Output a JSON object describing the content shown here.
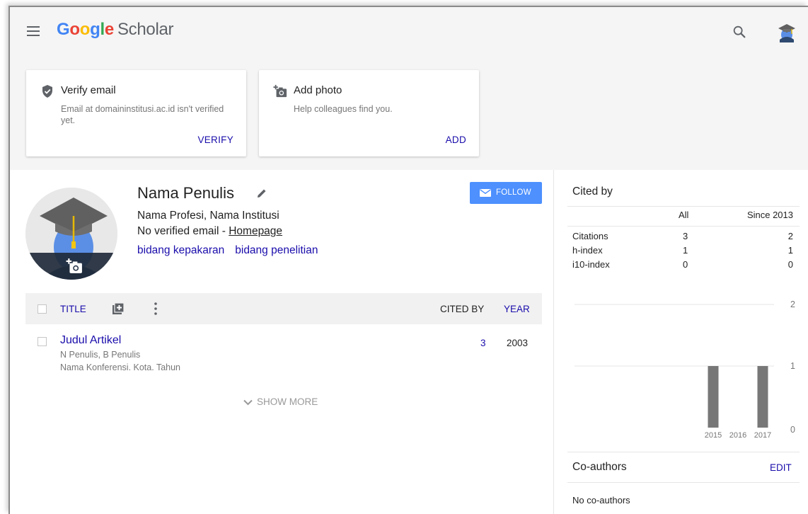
{
  "header": {
    "logo_google": [
      "G",
      "o",
      "o",
      "g",
      "l",
      "e"
    ],
    "logo_scholar": "Scholar"
  },
  "notifications": [
    {
      "title": "Verify email",
      "text": "Email at domaininstitusi.ac.id isn't verified yet.",
      "action": "VERIFY"
    },
    {
      "title": "Add photo",
      "text": "Help colleagues find you.",
      "action": "ADD"
    }
  ],
  "profile": {
    "name": "Nama Penulis",
    "affiliation": "Nama Profesi, Nama Institusi",
    "email_status": "No verified email - ",
    "homepage_label": "Homepage",
    "interests": [
      "bidang kepakaran",
      "bidang penelitian"
    ],
    "follow_label": "FOLLOW"
  },
  "articles": {
    "columns": {
      "title": "TITLE",
      "cited_by": "CITED BY",
      "year": "YEAR"
    },
    "rows": [
      {
        "title": "Judul Artikel",
        "authors": "N Penulis, B Penulis",
        "venue": "Nama Konferensi. Kota. Tahun",
        "cited_by": "3",
        "year": "2003"
      }
    ],
    "show_more": "SHOW MORE"
  },
  "cited_by": {
    "title": "Cited by",
    "headers": [
      "All",
      "Since 2013"
    ],
    "metrics": [
      {
        "label": "Citations",
        "all": "3",
        "since": "2"
      },
      {
        "label": "h-index",
        "all": "1",
        "since": "1"
      },
      {
        "label": "i10-index",
        "all": "0",
        "since": "0"
      }
    ]
  },
  "chart_data": {
    "type": "bar",
    "categories": [
      "2015",
      "2016",
      "2017"
    ],
    "values": [
      1,
      0,
      1
    ],
    "ylim": [
      0,
      2
    ],
    "yticks": [
      "0",
      "1",
      "2"
    ],
    "grid": true,
    "bar_color": "#777777"
  },
  "coauthors": {
    "title": "Co-authors",
    "edit_label": "EDIT",
    "empty_text": "No co-authors"
  },
  "colors": {
    "link": "#1a0dab",
    "follow_button": "#4d90fe",
    "band_background": "#f5f5f5"
  }
}
